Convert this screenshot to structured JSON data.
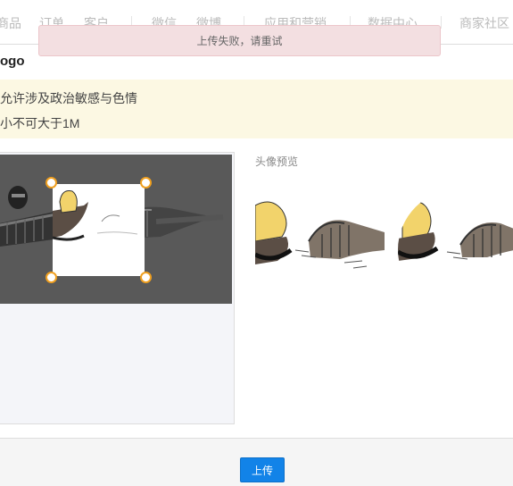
{
  "nav": {
    "items": [
      {
        "id": "goods",
        "label": "商品"
      },
      {
        "id": "orders",
        "label": "订单"
      },
      {
        "id": "customers",
        "label": "客户"
      },
      {
        "id": "wechat",
        "label": "微信"
      },
      {
        "id": "weibo",
        "label": "微博"
      },
      {
        "id": "apps",
        "label": "应用和营销"
      },
      {
        "id": "data",
        "label": "数据中心"
      },
      {
        "id": "community",
        "label": "商家社区"
      }
    ]
  },
  "toast": {
    "message": "上传失败，请重试"
  },
  "page": {
    "title": "ogo"
  },
  "notice": {
    "line1": "允许涉及政治敏感与色情",
    "line2": "小不可大于1M"
  },
  "preview": {
    "label": "头像预览"
  },
  "footer": {
    "upload_label": "上传"
  }
}
